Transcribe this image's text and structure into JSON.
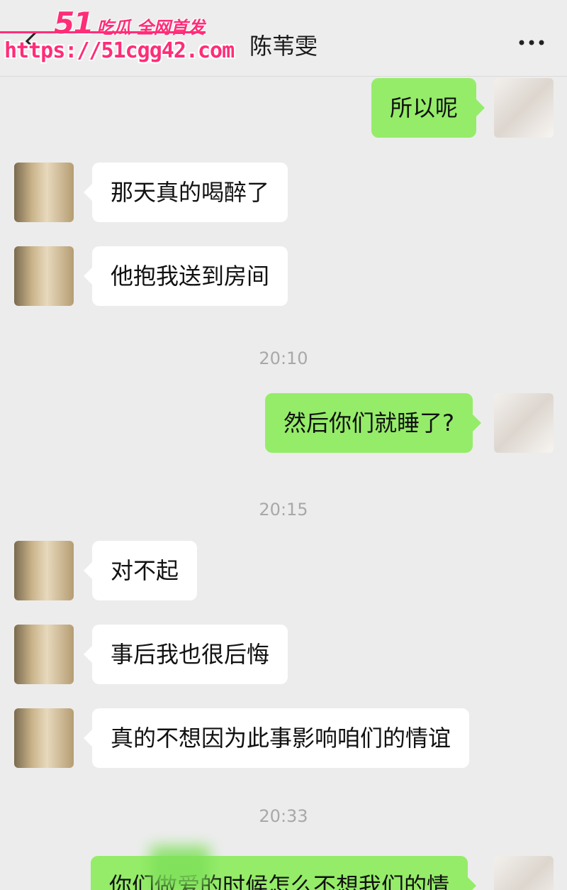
{
  "header": {
    "title": "陈苇雯"
  },
  "watermark": {
    "brand": "51",
    "tagline": "吃瓜 全网首发",
    "url": "https://51cgg42.com"
  },
  "messages": [
    {
      "side": "right",
      "text": "所以呢"
    },
    {
      "side": "left",
      "text": "那天真的喝醉了"
    },
    {
      "side": "left",
      "text": "他抱我送到房间"
    },
    {
      "side": "right",
      "text": "然后你们就睡了?"
    },
    {
      "side": "left",
      "text": "对不起"
    },
    {
      "side": "left",
      "text": "事后我也很后悔"
    },
    {
      "side": "left",
      "text": "真的不想因为此事影响咱们的情谊"
    },
    {
      "side": "right",
      "text": "你们做爱的时候怎么不想我们的情"
    }
  ],
  "timestamps": [
    "20:10",
    "20:15",
    "20:33"
  ],
  "colors": {
    "sent_bubble": "#95ec69",
    "received_bubble": "#ffffff",
    "watermark": "#ff2d78",
    "background": "#ececec"
  },
  "icons": {
    "back": "chevron-left-icon",
    "more": "more-dots-icon"
  }
}
